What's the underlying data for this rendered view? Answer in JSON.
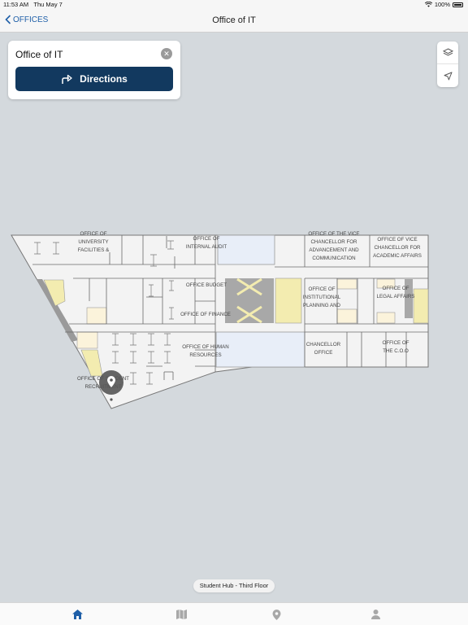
{
  "status_bar": {
    "time": "11:53 AM",
    "date": "Thu May 7",
    "battery": "100%"
  },
  "nav": {
    "back_label": "OFFICES",
    "title": "Office of IT"
  },
  "search": {
    "value": "Office of IT",
    "directions_label": "Directions"
  },
  "map": {
    "floor_label": "Student Hub - Third Floor",
    "rooms": {
      "university_facilities": [
        "OFFICE OF",
        "UNIVERSITY",
        "FACILITIES &"
      ],
      "internal_audit": [
        "OFFICE OF",
        "INTERNAL AUDIT"
      ],
      "vc_advancement": [
        "OFFICE OF THE VICE",
        "CHANCELLOR FOR",
        "ADVANCEMENT AND",
        "COMMUNICATION"
      ],
      "vc_academic": [
        "OFFICE OF VICE",
        "CHANCELLOR FOR",
        "ACADEMIC AFFAIRS"
      ],
      "budget": [
        "OFFICE BUDGET"
      ],
      "finance": [
        "OFFICE OF FINANCE"
      ],
      "institutional_planning": [
        "OFFICE OF",
        "INSTITUTIONAL",
        "PLANNING AND"
      ],
      "legal_affairs": [
        "OFFICE OF",
        "LEGAL AFFAIRS"
      ],
      "human_resources": [
        "OFFICE OF HUMAN",
        "RESOURCES"
      ],
      "chancellor": [
        "CHANCELLOR",
        "OFFICE"
      ],
      "coo": [
        "OFFICE OF",
        "THE C.O.O"
      ],
      "recruitment": [
        "OFFICE OF STUDENT",
        "RECRUITMENT"
      ]
    }
  },
  "icons": {
    "back": "chevron-left-icon",
    "wifi": "wifi-icon",
    "clear": "close-circle-icon",
    "directions": "turn-right-arrow-icon",
    "layers": "layers-icon",
    "locate": "location-arrow-icon",
    "pin": "map-pin-icon",
    "tabs": [
      "home-icon",
      "map-icon",
      "pin-icon",
      "person-icon"
    ]
  },
  "colors": {
    "accent": "#1f5fa8",
    "button": "#12395f",
    "selected_room": "#e8eef8",
    "restroom": "#f3ecb0"
  }
}
